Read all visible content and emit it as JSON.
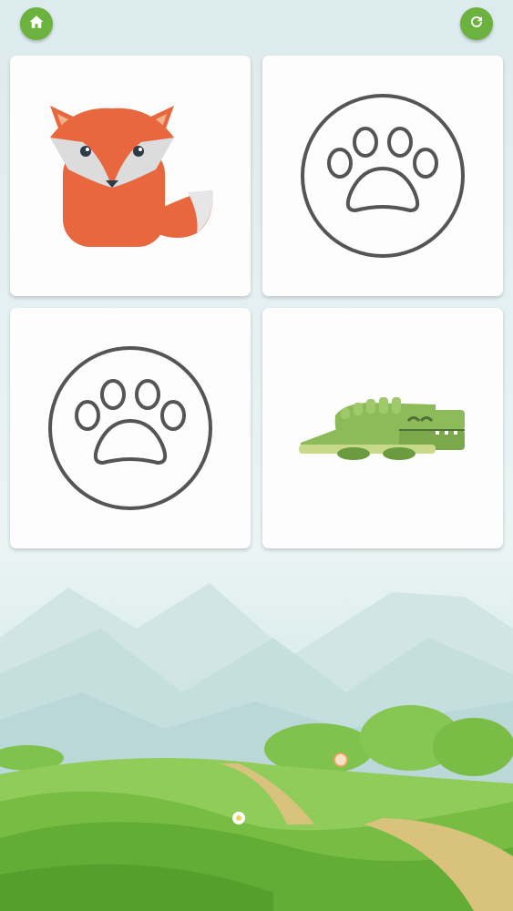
{
  "header": {
    "home_icon": "home-icon",
    "restart_icon": "restart-icon",
    "button_color": "#6cb23f"
  },
  "board": {
    "cards": [
      {
        "state": "revealed",
        "content": "fox"
      },
      {
        "state": "hidden",
        "content": "paw-icon"
      },
      {
        "state": "hidden",
        "content": "paw-icon"
      },
      {
        "state": "revealed",
        "content": "crocodile"
      }
    ]
  }
}
